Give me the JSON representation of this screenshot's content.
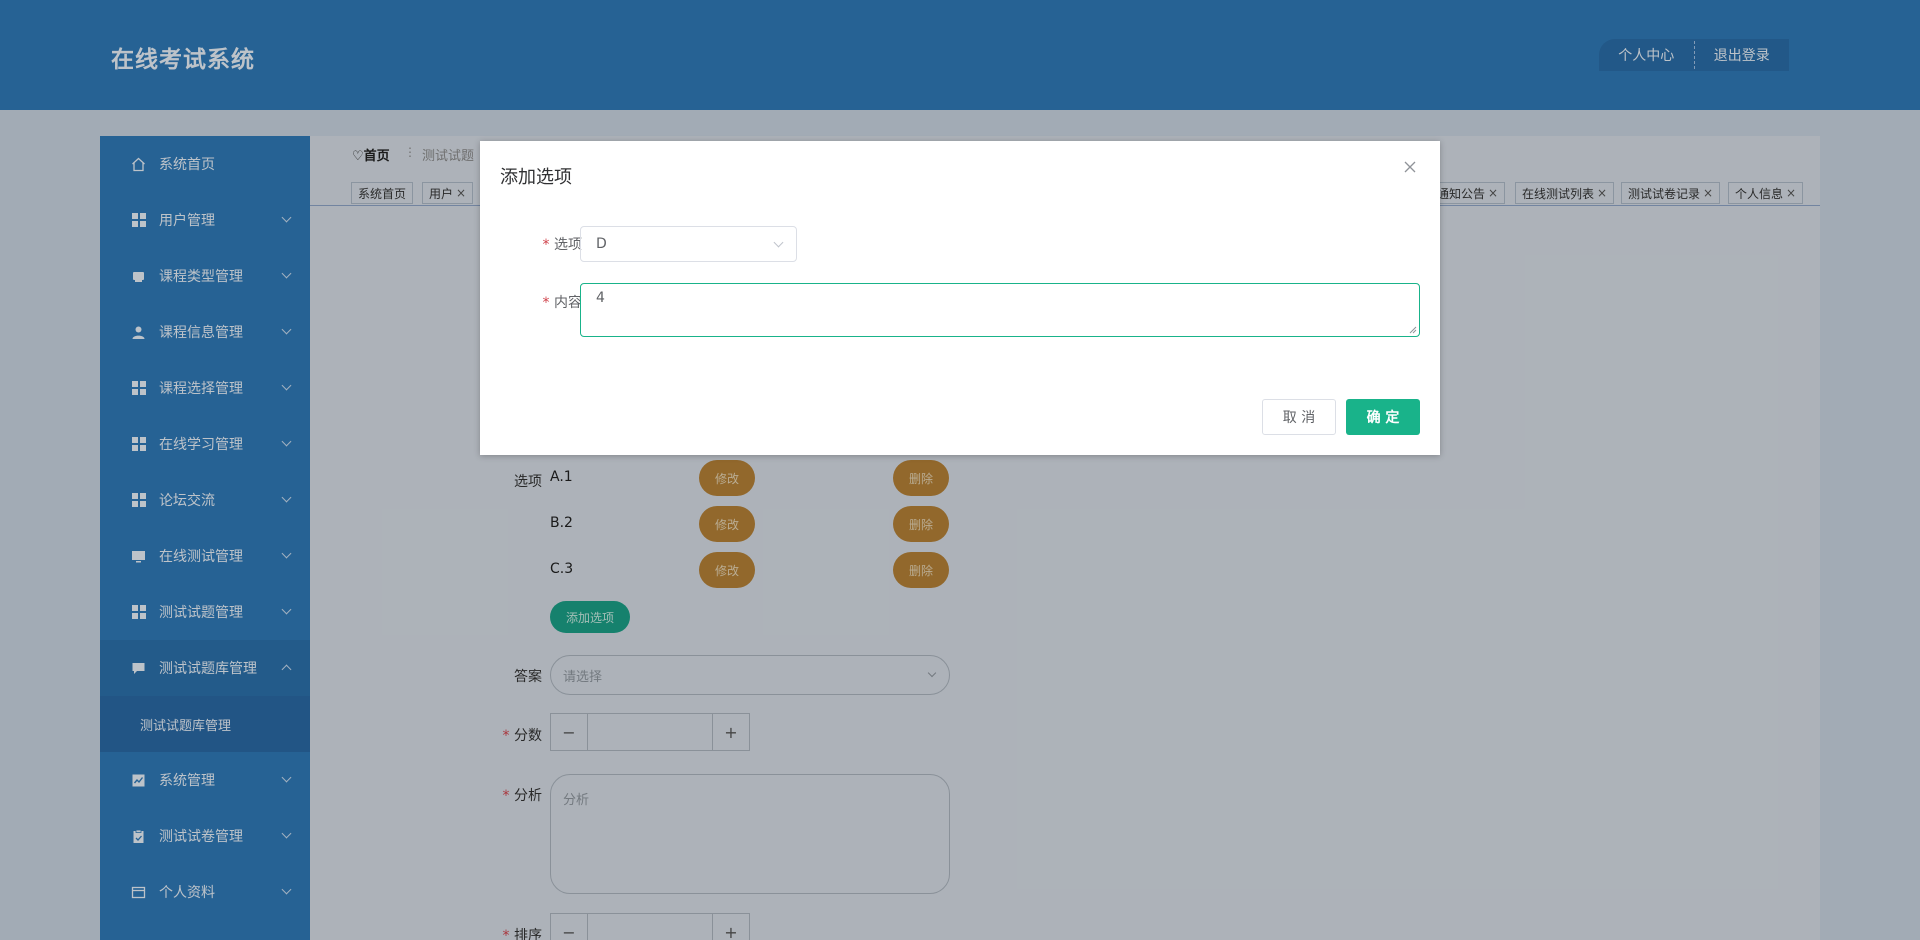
{
  "header": {
    "title": "在线考试系统",
    "personal_center": "个人中心",
    "logout": "退出登录"
  },
  "sidebar": {
    "items": [
      {
        "label": "系统首页",
        "icon": "home-icon"
      },
      {
        "label": "用户管理",
        "icon": "grid-icon"
      },
      {
        "label": "课程类型管理",
        "icon": "book-icon"
      },
      {
        "label": "课程信息管理",
        "icon": "user-icon"
      },
      {
        "label": "课程选择管理",
        "icon": "grid-icon"
      },
      {
        "label": "在线学习管理",
        "icon": "grid-icon"
      },
      {
        "label": "论坛交流",
        "icon": "grid-icon"
      },
      {
        "label": "在线测试管理",
        "icon": "monitor-icon"
      },
      {
        "label": "测试试题管理",
        "icon": "grid-icon"
      },
      {
        "label": "测试试题库管理",
        "icon": "chat-icon"
      },
      {
        "label": "系统管理",
        "icon": "chart-icon"
      },
      {
        "label": "测试试卷管理",
        "icon": "clipboard-icon"
      },
      {
        "label": "个人资料",
        "icon": "card-icon"
      }
    ],
    "submenu_label": "测试试题库管理"
  },
  "breadcrumb": {
    "home": "首页",
    "separator": "⋮",
    "current": "测试试题"
  },
  "tabs": [
    "系统首页",
    "用户",
    "通知公告",
    "在线测试列表",
    "测试试卷记录",
    "个人信息"
  ],
  "tab_close": "×",
  "form": {
    "options_label": "选项",
    "options": [
      {
        "text": "A.1",
        "edit": "修改",
        "delete": "删除"
      },
      {
        "text": "B.2",
        "edit": "修改",
        "delete": "删除"
      },
      {
        "text": "C.3",
        "edit": "修改",
        "delete": "删除"
      }
    ],
    "add_option": "添加选项",
    "answer_label": "答案",
    "answer_placeholder": "请选择",
    "score_label": "分数",
    "analysis_label": "分析",
    "analysis_placeholder": "分析",
    "order_label": "排序",
    "required_mark": "*",
    "minus": "−",
    "plus": "+"
  },
  "dialog": {
    "title": "添加选项",
    "option_label": "选项",
    "option_value": "D",
    "content_label": "内容",
    "content_value": "4",
    "cancel": "取 消",
    "confirm": "确 定"
  },
  "colors": {
    "primary": "#2f78b5",
    "accent": "#19b38a",
    "pill": "#b27f36",
    "required": "#d0424b"
  }
}
